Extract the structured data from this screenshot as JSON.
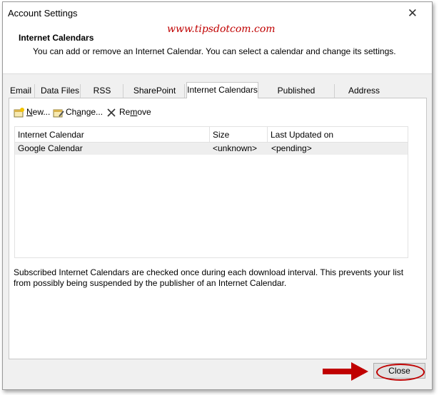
{
  "window": {
    "title": "Account Settings"
  },
  "watermark": "www.tipsdotcom.com",
  "header": {
    "title": "Internet Calendars",
    "description": "You can add or remove an Internet Calendar. You can select a calendar and change its settings."
  },
  "tabs": [
    {
      "label": "Email"
    },
    {
      "label": "Data Files"
    },
    {
      "label": "RSS Feeds"
    },
    {
      "label": "SharePoint Lists"
    },
    {
      "label": "Internet Calendars",
      "active": true
    },
    {
      "label": "Published Calendars"
    },
    {
      "label": "Address Books"
    }
  ],
  "toolbar": {
    "new_label_u": "N",
    "new_label_rest": "ew...",
    "change_label_pre": "Ch",
    "change_label_u": "a",
    "change_label_rest": "nge...",
    "remove_label_pre": "Re",
    "remove_label_u": "m",
    "remove_label_rest": "ove"
  },
  "table": {
    "headers": [
      "Internet Calendar",
      "Size",
      "Last Updated on"
    ],
    "rows": [
      [
        "Google Calendar",
        "<unknown>",
        "<pending>"
      ]
    ]
  },
  "footnote": "Subscribed Internet Calendars are checked once during each download interval. This prevents your list from possibly being suspended by the publisher of an Internet Calendar.",
  "buttons": {
    "close": "Close"
  },
  "colors": {
    "annotation_red": "#c00000"
  }
}
